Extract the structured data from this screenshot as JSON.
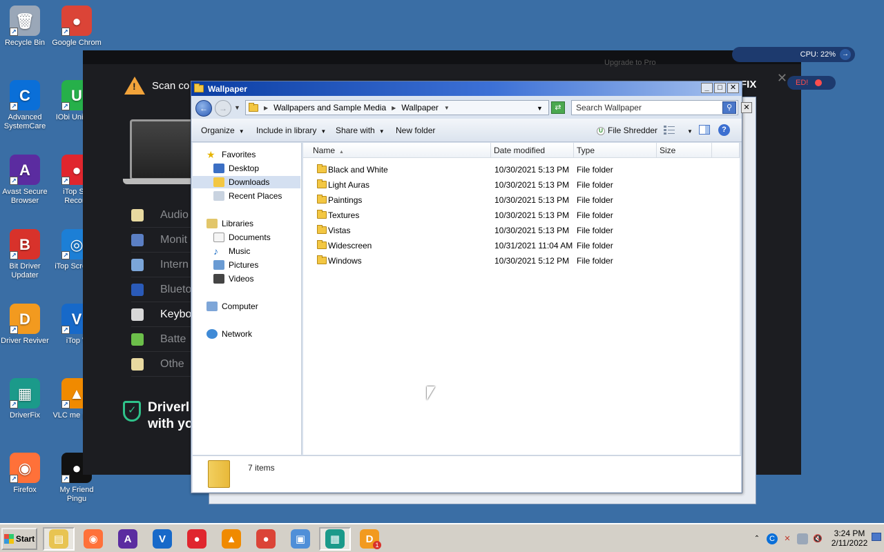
{
  "desktop": {
    "icons": [
      {
        "label": "Recycle Bin",
        "icon": "recycle-bin-icon",
        "color": "#9aa7b8"
      },
      {
        "label": "Google Chrom",
        "icon": "chrome-icon",
        "color": "#db4437"
      },
      {
        "label": "Advanced SystemCare",
        "icon": "advanced-systemcare-icon",
        "color": "#0a6fd8"
      },
      {
        "label": "IObi Uninsta",
        "icon": "iobit-uninstaller-icon",
        "color": "#26b04a"
      },
      {
        "label": "Avast Secure Browser",
        "icon": "avast-browser-icon",
        "color": "#5b2ca0"
      },
      {
        "label": "iTop Scr Record",
        "icon": "itop-recorder-icon",
        "color": "#e0262e"
      },
      {
        "label": "Bit Driver Updater",
        "icon": "bit-driver-updater-icon",
        "color": "#d8322b"
      },
      {
        "label": "iTop Screens",
        "icon": "itop-screenshot-icon",
        "color": "#1c7fd6"
      },
      {
        "label": "Driver Reviver",
        "icon": "driver-reviver-icon",
        "color": "#f29a1f"
      },
      {
        "label": "iTop V",
        "icon": "itop-vpn-icon",
        "color": "#1769c9"
      },
      {
        "label": "DriverFix",
        "icon": "driverfix-icon",
        "color": "#1b9a8a"
      },
      {
        "label": "VLC me playe",
        "icon": "vlc-icon",
        "color": "#f08a00"
      },
      {
        "label": "Firefox",
        "icon": "firefox-icon",
        "color": "#ff7139"
      },
      {
        "label": "My Friend Pingu",
        "icon": "pingu-icon",
        "color": "#111111"
      }
    ]
  },
  "driverfix": {
    "scan_text": "Scan co",
    "brand_fragment": "FIX",
    "upgrade_fragment": "Upgrade to Pro",
    "categories": [
      "Audio",
      "Monit",
      "Intern",
      "Blueto",
      "Keybo",
      "Batte",
      "Othe"
    ],
    "bottom_line1": "Driverl",
    "bottom_line2": "with yo"
  },
  "overlay": {
    "cpu_label": "CPU: 22%",
    "alert_label": "ED!"
  },
  "explorer": {
    "title": "Wallpaper",
    "breadcrumb": [
      "Wallpapers and Sample Media",
      "Wallpaper"
    ],
    "search_placeholder": "Search Wallpaper",
    "toolbar": {
      "organize": "Organize",
      "include_in_library": "Include in library",
      "share_with": "Share with",
      "new_folder": "New folder",
      "file_shredder": "File Shredder"
    },
    "nav": {
      "favorites": "Favorites",
      "desktop": "Desktop",
      "downloads": "Downloads",
      "recent_places": "Recent Places",
      "libraries": "Libraries",
      "documents": "Documents",
      "music": "Music",
      "pictures": "Pictures",
      "videos": "Videos",
      "computer": "Computer",
      "network": "Network"
    },
    "columns": {
      "name": "Name",
      "date_modified": "Date modified",
      "type": "Type",
      "size": "Size"
    },
    "rows": [
      {
        "name": "Black and White",
        "date": "10/30/2021 5:13 PM",
        "type": "File folder"
      },
      {
        "name": "Light Auras",
        "date": "10/30/2021 5:13 PM",
        "type": "File folder"
      },
      {
        "name": "Paintings",
        "date": "10/30/2021 5:13 PM",
        "type": "File folder"
      },
      {
        "name": "Textures",
        "date": "10/30/2021 5:13 PM",
        "type": "File folder"
      },
      {
        "name": "Vistas",
        "date": "10/30/2021 5:13 PM",
        "type": "File folder"
      },
      {
        "name": "Widescreen",
        "date": "10/31/2021 11:04 AM",
        "type": "File folder"
      },
      {
        "name": "Windows",
        "date": "10/30/2021 5:12 PM",
        "type": "File folder"
      }
    ],
    "status": "7 items"
  },
  "taskbar": {
    "start_label": "Start",
    "apps": [
      {
        "icon": "file-explorer-icon",
        "color": "#e8c452",
        "active": true
      },
      {
        "icon": "firefox-icon",
        "color": "#ff7139"
      },
      {
        "icon": "avast-browser-icon",
        "color": "#5b2ca0"
      },
      {
        "icon": "itop-vpn-icon",
        "color": "#1769c9"
      },
      {
        "icon": "itop-recorder-icon",
        "color": "#e0262e"
      },
      {
        "icon": "vlc-icon",
        "color": "#f08a00"
      },
      {
        "icon": "chrome-icon",
        "color": "#db4437"
      },
      {
        "icon": "remote-desktop-icon",
        "color": "#4f8fd8"
      },
      {
        "icon": "driverfix-icon",
        "color": "#1b9a8a",
        "active": true
      },
      {
        "icon": "driver-reviver-icon",
        "color": "#f29a1f",
        "badge": "1"
      }
    ],
    "time": "3:24 PM",
    "date": "2/11/2022"
  }
}
